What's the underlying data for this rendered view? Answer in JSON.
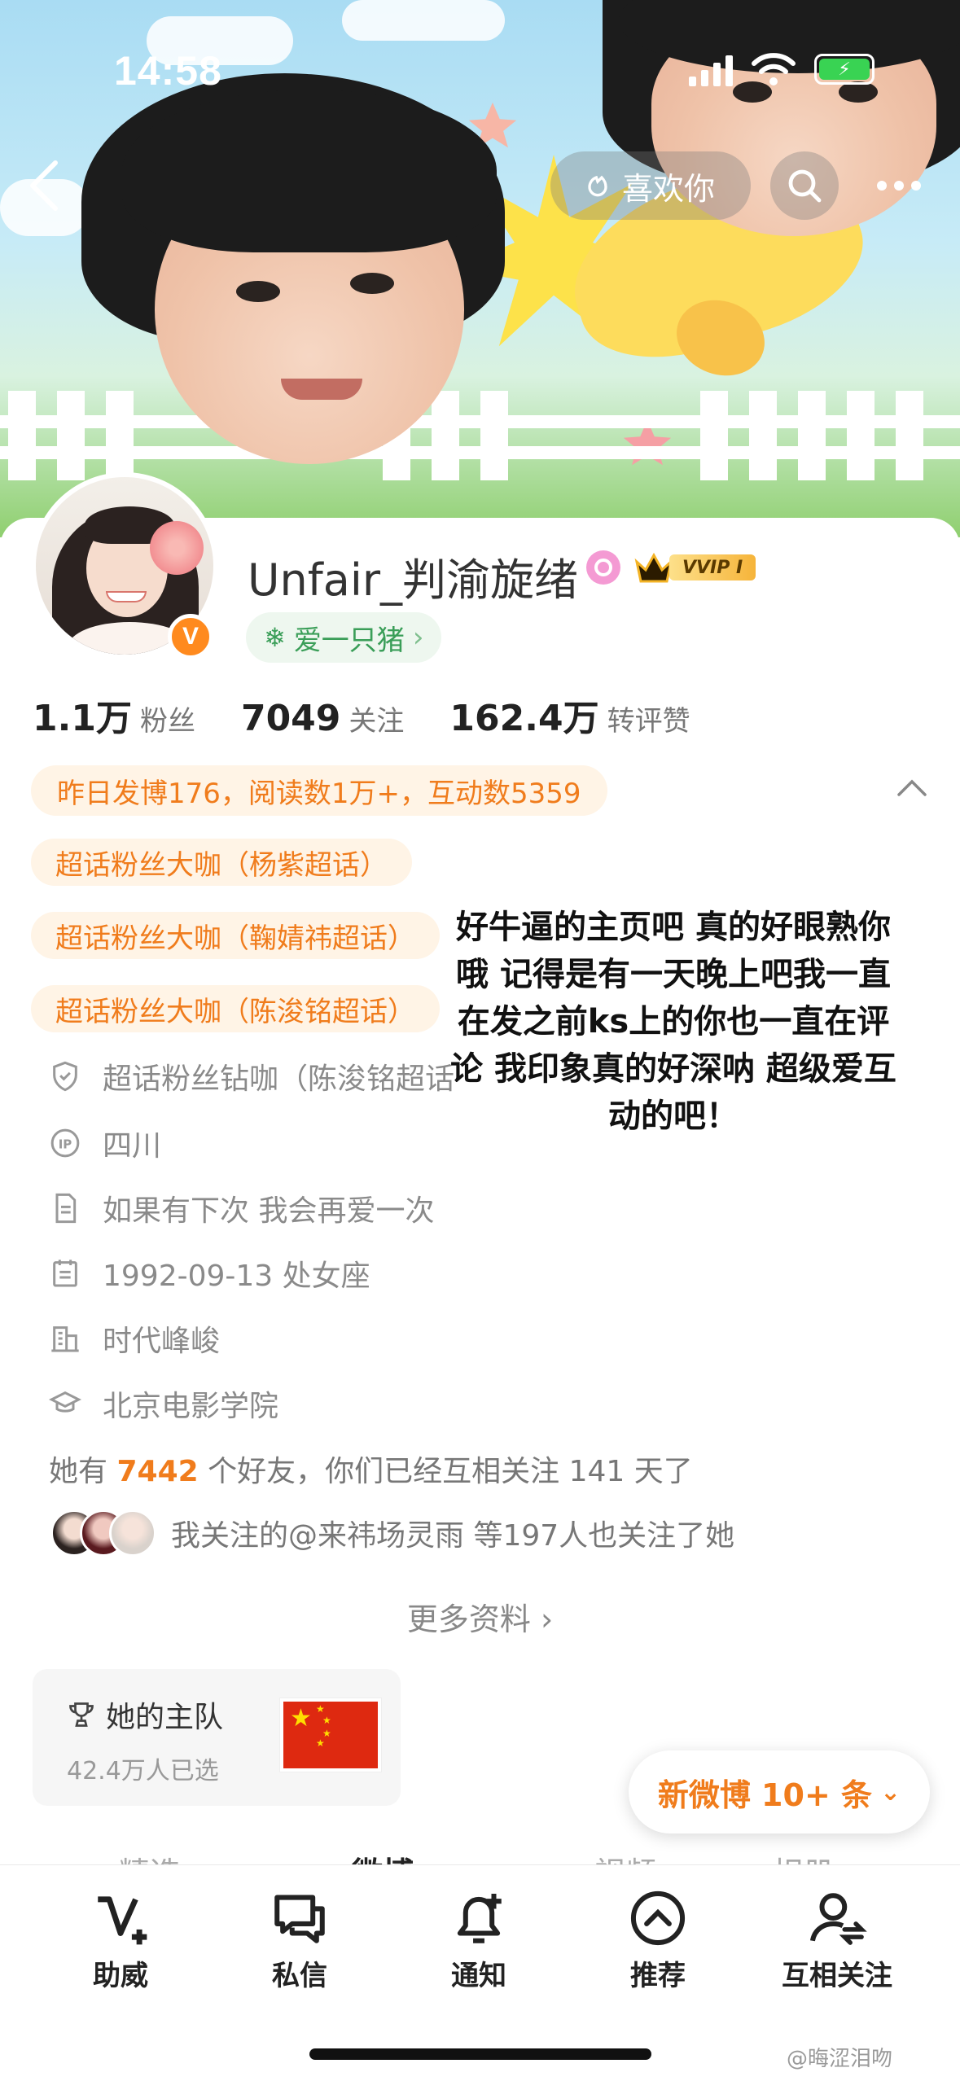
{
  "status": {
    "time": "14:58"
  },
  "header": {
    "like_label": "喜欢你"
  },
  "profile": {
    "name": "Unfair_判渝旋绪",
    "vip_label": "VVIP I",
    "verified_mark": "V",
    "tag": "爱一只猪",
    "stats": [
      {
        "num": "1.1万",
        "label": "粉丝"
      },
      {
        "num": "7049",
        "label": "关注"
      },
      {
        "num": "162.4万",
        "label": "转评赞"
      }
    ],
    "summary": "昨日发博176，阅读数1万+，互动数5359",
    "chips": [
      "超话粉丝大咖（杨紫超话）",
      "超话粉丝大咖（鞠婧祎超话）",
      "超话粉丝大咖（陈浚铭超话）"
    ],
    "info": [
      {
        "icon": "shield-icon",
        "text": "超话粉丝钻咖（陈浚铭超话"
      },
      {
        "icon": "ip-icon",
        "text": "四川"
      },
      {
        "icon": "document-icon",
        "text": "如果有下次 我会再爱一次"
      },
      {
        "icon": "calendar-icon",
        "text": "1992-09-13 处女座"
      },
      {
        "icon": "company-icon",
        "text": "时代峰峻"
      },
      {
        "icon": "graduation-cap-icon",
        "text": "北京电影学院"
      }
    ],
    "friends_prefix": "她有",
    "friends_count": "7442",
    "friends_suffix": "个好友，你们已经互相关注 141 天了",
    "mutual_text": "我关注的@来祎场灵雨 等197人也关注了她",
    "more_label": "更多资料 ›"
  },
  "overlay_text": "好牛逼的主页吧 真的好眼熟你哦 记得是有一天晚上吧我一直在发之前ks上的你也一直在评论 我印象真的好深呐 超级爱互动的吧！",
  "team": {
    "title": "她的主队",
    "subtitle": "42.4万人已选"
  },
  "new_posts": "新微博 10+ 条",
  "tabs": [
    "精选",
    "微博",
    "视频",
    "相册"
  ],
  "bottom_nav": [
    {
      "icon": "v-plus-icon",
      "label": "助威"
    },
    {
      "icon": "chat-icon",
      "label": "私信"
    },
    {
      "icon": "bell-plus-icon",
      "label": "通知"
    },
    {
      "icon": "chevron-up-circle-icon",
      "label": "推荐"
    },
    {
      "icon": "mutual-follow-icon",
      "label": "互相关注"
    }
  ],
  "watermark": "@晦涩泪吻",
  "colors": {
    "accent": "#f07c1c",
    "green": "#3a9e58"
  }
}
